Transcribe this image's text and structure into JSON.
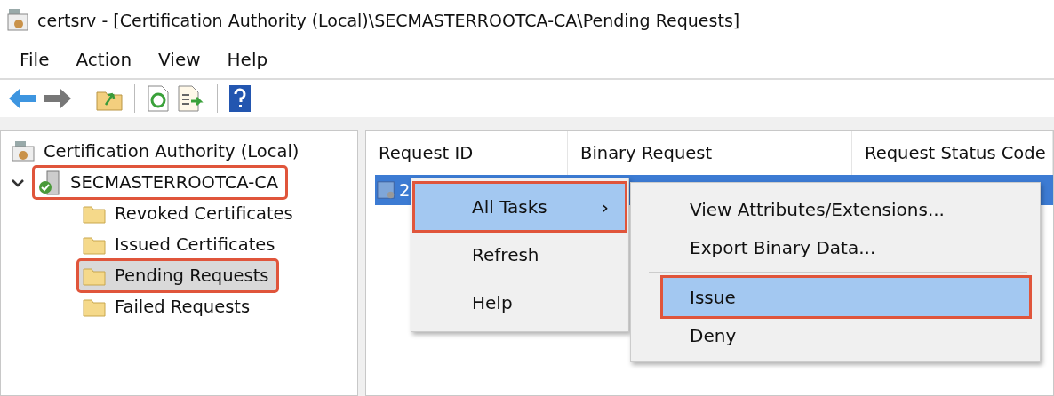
{
  "window": {
    "title": "certsrv - [Certification Authority (Local)\\SECMASTERROOTCA-CA\\Pending Requests]"
  },
  "menu": [
    "File",
    "Action",
    "View",
    "Help"
  ],
  "tree": {
    "label": "Certification Authority (Local)",
    "children": [
      {
        "label": "SECMASTERROOTCA-CA",
        "expanded": true,
        "highlighted": true,
        "children": [
          {
            "label": "Revoked Certificates",
            "selected": false,
            "highlighted": false
          },
          {
            "label": "Issued Certificates",
            "selected": false,
            "highlighted": false
          },
          {
            "label": "Pending Requests",
            "selected": true,
            "highlighted": true
          },
          {
            "label": "Failed Requests",
            "selected": false,
            "highlighted": false
          }
        ]
      }
    ]
  },
  "table": {
    "columns": [
      "Request ID",
      "Binary Request",
      "Request Status Code"
    ],
    "rows": [
      {
        "cells": [
          "2"
        ],
        "selected": true
      }
    ]
  },
  "context_menu": {
    "items": [
      {
        "kind": "item",
        "label": "All Tasks",
        "arrow": "›",
        "selected": true,
        "highlighted": true
      },
      {
        "kind": "item",
        "label": "Refresh",
        "selected": false,
        "highlighted": false
      },
      {
        "kind": "item",
        "label": "Help",
        "selected": false,
        "highlighted": false
      }
    ]
  },
  "submenu": {
    "items": [
      {
        "kind": "item",
        "label": "View Attributes/Extensions...",
        "selected": false,
        "highlighted": false
      },
      {
        "kind": "item",
        "label": "Export Binary Data...",
        "selected": false,
        "highlighted": false
      },
      {
        "kind": "separator"
      },
      {
        "kind": "item",
        "label": "Issue",
        "selected": true,
        "highlighted": true
      },
      {
        "kind": "item",
        "label": "Deny",
        "selected": false,
        "highlighted": false
      }
    ]
  }
}
